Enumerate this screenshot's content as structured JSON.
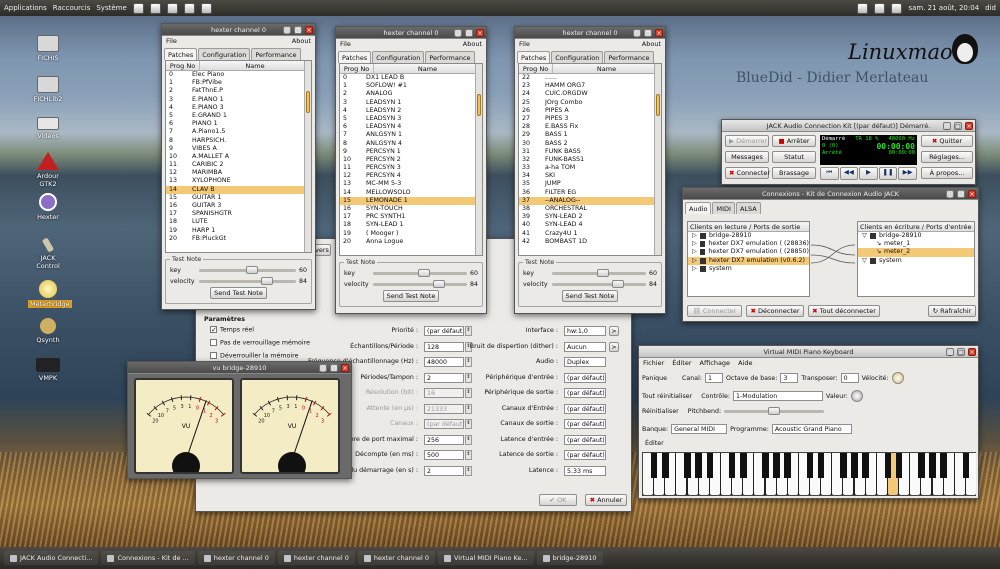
{
  "topbar": {
    "menus": [
      "Applications",
      "Raccourcis",
      "Système"
    ],
    "datetime": "sam. 21 août, 20:04",
    "user": "did"
  },
  "desktop": {
    "logo": "Linuxmao",
    "tagline": "BlueDid - Didier Merlateau",
    "icons": [
      {
        "label": "FICHIS"
      },
      {
        "label": "FICHLib2"
      },
      {
        "label": "Vidéos"
      },
      {
        "label": "Ardour GTK2"
      },
      {
        "label": "Hexter"
      },
      {
        "label": "JACK Control"
      },
      {
        "label": "Meterbridge"
      },
      {
        "label": "Qsynth"
      },
      {
        "label": "VMPK"
      }
    ]
  },
  "hexter": [
    {
      "title": "hexter channel 0",
      "tabs": [
        "Patches",
        "Configuration",
        "Performance"
      ],
      "cols": [
        "Prog No",
        "Name"
      ],
      "rows": [
        [
          "0",
          "Elec Piano"
        ],
        [
          "1",
          "FB:PfVibe"
        ],
        [
          "2",
          "FatThnE.P"
        ],
        [
          "3",
          "E.PIANO 1"
        ],
        [
          "4",
          "E.PIANO 3"
        ],
        [
          "5",
          "E.GRAND 1"
        ],
        [
          "6",
          "PIANO   1"
        ],
        [
          "7",
          "A.Piano1.5"
        ],
        [
          "8",
          "HARPSICH."
        ],
        [
          "9",
          "VIBES    A"
        ],
        [
          "10",
          "A.MALLET A"
        ],
        [
          "11",
          "CARIBIC 2"
        ],
        [
          "12",
          "MARIMBA"
        ],
        [
          "13",
          "XYLOPHONE"
        ],
        [
          "14",
          "CLAV     B"
        ],
        [
          "15",
          "GUITAR  1"
        ],
        [
          "16",
          "GUITAR  3"
        ],
        [
          "17",
          "SPANISHGTR"
        ],
        [
          "18",
          "LUTE"
        ],
        [
          "19",
          "HARP    1"
        ],
        [
          "20",
          "FB:PluckGt"
        ]
      ],
      "sel": 14
    },
    {
      "title": "hexter channel 0",
      "tabs": [
        "Patches",
        "Configuration",
        "Performance"
      ],
      "cols": [
        "Prog No",
        "Name"
      ],
      "rows": [
        [
          "0",
          "DX1 LEAD B"
        ],
        [
          "1",
          "SOFLOW! #1"
        ],
        [
          "2",
          "ANALOG"
        ],
        [
          "3",
          "LEADSYN 1"
        ],
        [
          "4",
          "LEADSYN 2"
        ],
        [
          "5",
          "LEADSYN 3"
        ],
        [
          "6",
          "LEADSYN 4"
        ],
        [
          "7",
          "ANLGSYN 1"
        ],
        [
          "8",
          "ANLGSYN 4"
        ],
        [
          "9",
          "PERCSYN 1"
        ],
        [
          "10",
          "PERCSYN 2"
        ],
        [
          "11",
          "PERCSYN 3"
        ],
        [
          "12",
          "PERCSYN 4"
        ],
        [
          "13",
          "MC-MM 5-3"
        ],
        [
          "14",
          "MELLOWSOLO"
        ],
        [
          "15",
          "LEMONADE 1"
        ],
        [
          "16",
          "SYN-TOUCH"
        ],
        [
          "17",
          "PRC SYNTH1"
        ],
        [
          "18",
          "SYN-LEAD 1"
        ],
        [
          "19",
          "( Mooger )"
        ],
        [
          "20",
          "Anna Logue"
        ]
      ],
      "sel": 15
    },
    {
      "title": "hexter channel 0",
      "tabs": [
        "Patches",
        "Configuration",
        "Performance"
      ],
      "cols": [
        "Prog No",
        "Name"
      ],
      "rows": [
        [
          "22",
          "......"
        ],
        [
          "23",
          "HAMM ORG7"
        ],
        [
          "24",
          "CUIC.ORGDW"
        ],
        [
          "25",
          "JOrg Combo"
        ],
        [
          "26",
          "PIPES   A"
        ],
        [
          "27",
          "PIPES   3"
        ],
        [
          "28",
          "E.BASS Fix"
        ],
        [
          "29",
          "BASS    1"
        ],
        [
          "30",
          "BASS    2"
        ],
        [
          "31",
          "FUNK BASS"
        ],
        [
          "32",
          "FUNK-BASS1"
        ],
        [
          "33",
          "a-ha TOM"
        ],
        [
          "34",
          "SKI"
        ],
        [
          "35",
          "JUMP"
        ],
        [
          "36",
          "FILTER EG"
        ],
        [
          "37",
          "--ANALOG--"
        ],
        [
          "38",
          "ORCHESTRAL"
        ],
        [
          "39",
          "SYN-LEAD 2"
        ],
        [
          "40",
          "SYN-LEAD 4"
        ],
        [
          "41",
          "Crazy4U  1"
        ],
        [
          "42",
          "BOMBAST 1D"
        ]
      ],
      "sel": 15
    }
  ],
  "testnote": {
    "legend": "Test Note",
    "key_label": "key",
    "key_value": "60",
    "velocity_label": "velocity",
    "velocity_value": "84",
    "button": "Send Test Note"
  },
  "menu": {
    "file": "File",
    "about": "About"
  },
  "jackctl": {
    "title": "JACK Audio Connection Kit [(par défaut)] Démarré.",
    "buttons": [
      "Démarrer",
      "Arrêter",
      "Quitter",
      "Messages",
      "Statut",
      "Réglages...",
      "Connecter",
      "Brassage",
      "À propos..."
    ],
    "status": {
      "state": "Démarré",
      "rt": "TR",
      "cpu": "18 %",
      "rate": "48000 Hz",
      "xruns": "0 (0)",
      "time": "00:00:00",
      "clock": "00:00:00",
      "mode": "Arrêté"
    }
  },
  "connect": {
    "title": "Connexions - Kit de Connexion Audio JACK",
    "tabs": [
      "Audio",
      "MIDI",
      "ALSA"
    ],
    "left_header": "Clients en lecture / Ports de sortie",
    "right_header": "Clients en écriture / Ports d'entrée",
    "left_items": [
      "bridge-28910",
      "hexter DX7 emulation ( (28836)",
      "hexter DX7 emulation ( (28850)",
      "hexter DX7 emulation (v0.6.2)",
      "system"
    ],
    "left_sel": 3,
    "right_items": [
      "bridge-28910",
      "meter_1",
      "meter_2",
      "system"
    ],
    "right_sel": 2,
    "buttons": [
      "Connecter",
      "Déconnecter",
      "Tout déconnecter",
      "Rafraîchir"
    ]
  },
  "settings": {
    "section": "Paramètres",
    "checks": [
      {
        "label": "Temps réel",
        "on": true
      },
      {
        "label": "Pas de verrouillage mémoire",
        "on": false
      },
      {
        "label": "Déverrouiller la mémoire",
        "on": false
      }
    ],
    "left": [
      [
        "Priorité :",
        "(par défaut)",
        false
      ],
      [
        "Échantillons/Période :",
        "128",
        false
      ],
      [
        "Fréquence d'échantillonnage (Hz) :",
        "48000",
        false
      ],
      [
        "Périodes/Tampon :",
        "2",
        false
      ],
      [
        "Résolution (bit) :",
        "16",
        true
      ],
      [
        "Attente (en µs) :",
        "21333",
        true
      ],
      [
        "Canaux :",
        "(par défaut)",
        true
      ],
      [
        "Nombre de port maximal :",
        "256",
        false
      ],
      [
        "Décompte (en ms) :",
        "500",
        false
      ],
      [
        "Retard du démarrage (en s) :",
        "2",
        false
      ]
    ],
    "right": [
      [
        "Interface :",
        "hw:1,0"
      ],
      [
        "Bruit de dispertion (dither) :",
        "Aucun"
      ],
      [
        "Audio :",
        "Duplex"
      ],
      [
        "Périphérique d'entrée :",
        "(par défaut)"
      ],
      [
        "Périphérique de sortie :",
        "(par défaut)"
      ],
      [
        "Canaux d'Entrée :",
        "(par défaut)"
      ],
      [
        "Canaux de sortie :",
        "(par défaut)"
      ],
      [
        "Latence d'entrée :",
        "(par défaut)"
      ],
      [
        "Latence de sortie :",
        "(par défaut)"
      ],
      [
        "Latence :",
        "5.33 ms"
      ]
    ],
    "ok": "OK",
    "cancel": "Annuler",
    "partial": "vers"
  },
  "meter": {
    "title": "vu bridge-28910",
    "label": "VU",
    "scale": [
      "20",
      "10",
      "7",
      "5",
      "3",
      "1",
      "0",
      "1",
      "2",
      "3"
    ],
    "levels": [
      0.74,
      0.74
    ]
  },
  "vmpk": {
    "title": "Virtual MIDI Piano Keyboard",
    "menus": [
      "Fichier",
      "Éditer",
      "Affichage",
      "Aide"
    ],
    "panic": "Panique",
    "channel_label": "Canal:",
    "channel": "1",
    "octave_label": "Octave de base:",
    "octave": "3",
    "transpose_label": "Transposer:",
    "transpose": "0",
    "velocity_label": "Vélocité:",
    "reset": "Tout réinitialiser",
    "control_label": "Contrôle:",
    "control": "1-Modulation",
    "value_label": "Valeur:",
    "reinit": "Réinitialiser",
    "pitch_label": "Pitchbend:",
    "bank_label": "Banque:",
    "bank": "General MIDI",
    "program_label": "Programme:",
    "program": "Acoustic Grand Piano",
    "editor": "Éditer"
  },
  "taskbar": [
    "JACK Audio Connecti...",
    "Connexions - Kit de ...",
    "hexter channel 0",
    "hexter channel 0",
    "hexter channel 0",
    "Virtual MIDI Piano Ke...",
    "bridge-28910"
  ]
}
